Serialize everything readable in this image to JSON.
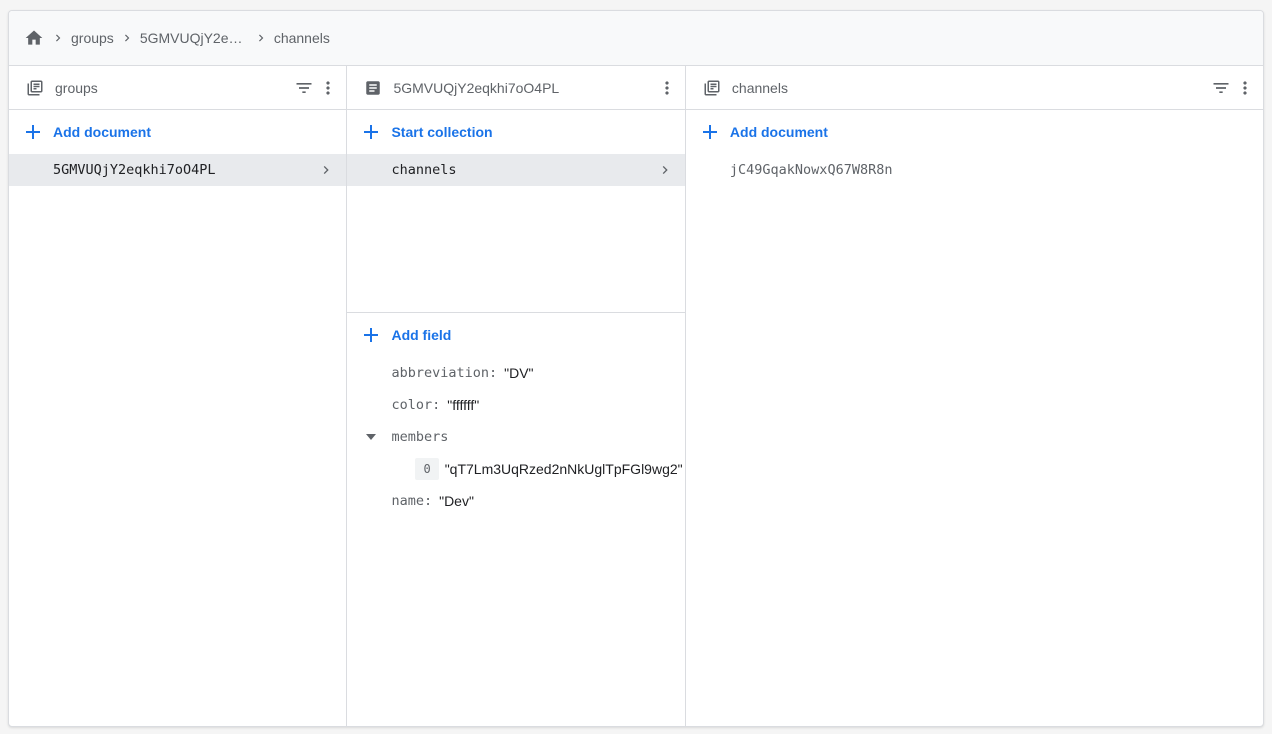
{
  "breadcrumb": {
    "home_icon": "home-icon",
    "items": [
      "groups",
      "5GMVUQjY2eqk...",
      "channels"
    ]
  },
  "columns": [
    {
      "header_icon": "collection-icon",
      "title": "groups",
      "action_label": "Add document",
      "items": [
        {
          "label": "5GMVUQjY2eqkhi7oO4PL",
          "selected": true
        }
      ]
    },
    {
      "header_icon": "document-icon",
      "title": "5GMVUQjY2eqkhi7oO4PL",
      "action_label": "Start collection",
      "items": [
        {
          "label": "channels",
          "selected": true
        }
      ],
      "field_action_label": "Add field",
      "fields": [
        {
          "key": "abbreviation:",
          "value": "\"DV\""
        },
        {
          "key": "color:",
          "value": "\"ffffff\""
        },
        {
          "key": "members",
          "items": [
            {
              "index": "0",
              "value": "\"qT7Lm3UqRzed2nNkUglTpFGl9wg2\""
            }
          ]
        },
        {
          "key": "name:",
          "value": "\"Dev\""
        }
      ]
    },
    {
      "header_icon": "collection-icon",
      "title": "channels",
      "action_label": "Add document",
      "items": [
        {
          "label": "jC49GqakNowxQ67W8R8n",
          "selected": false
        }
      ]
    }
  ],
  "colors": {
    "accent": "#1a73e8",
    "selected_row": "#e8eaed",
    "muted_text": "#5f6368",
    "border": "#dadce0"
  }
}
